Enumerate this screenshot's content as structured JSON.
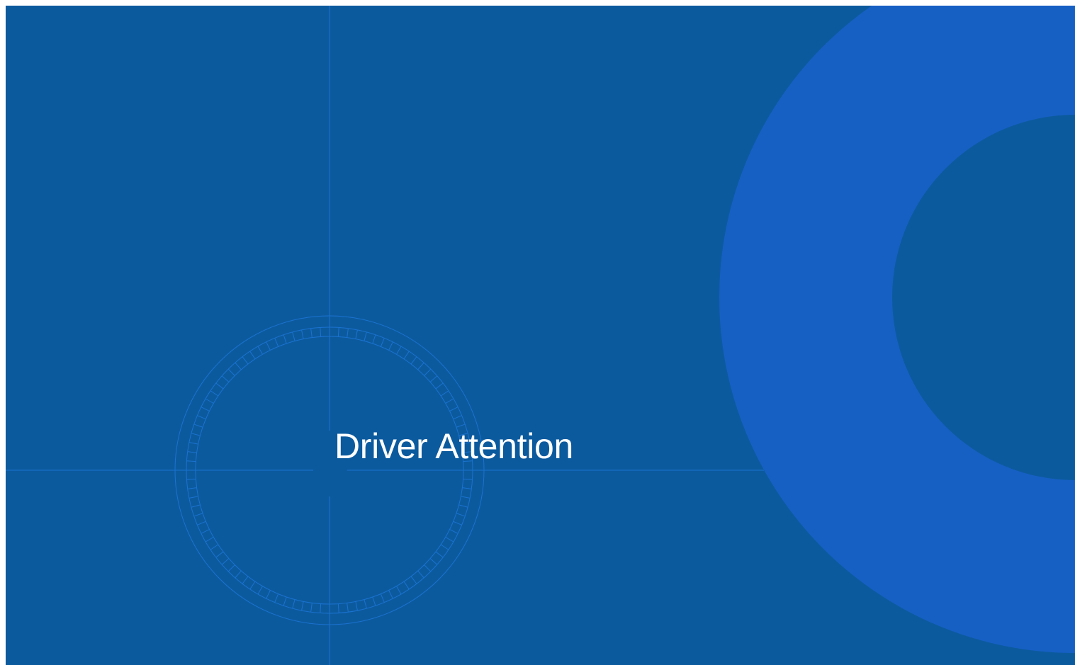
{
  "slide": {
    "title": "Driver Attention"
  },
  "colors": {
    "background": "#0c5a9e",
    "ring": "#1660c4",
    "ring_inner": "#0c5a9e",
    "guide_lines": "#1a73d0",
    "title_text": "#ffffff"
  }
}
